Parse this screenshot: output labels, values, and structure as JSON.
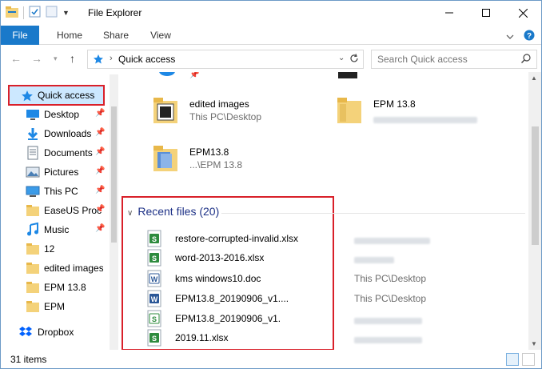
{
  "window": {
    "title": "File Explorer"
  },
  "ribbon": {
    "tabs": [
      "File",
      "Home",
      "Share",
      "View"
    ]
  },
  "address": {
    "path": "Quick access"
  },
  "search": {
    "placeholder": "Search Quick access"
  },
  "nav": {
    "quick_access": "Quick access",
    "items": [
      {
        "label": "Desktop",
        "icon": "desktop-icon",
        "pinned": true
      },
      {
        "label": "Downloads",
        "icon": "downloads-icon",
        "pinned": true
      },
      {
        "label": "Documents",
        "icon": "documents-icon",
        "pinned": true
      },
      {
        "label": "Pictures",
        "icon": "pictures-icon",
        "pinned": true
      },
      {
        "label": "This PC",
        "icon": "this-pc-icon",
        "pinned": true
      },
      {
        "label": "EaseUS Proc",
        "icon": "folder-icon",
        "pinned": true
      },
      {
        "label": "Music",
        "icon": "music-icon",
        "pinned": true
      },
      {
        "label": "12",
        "icon": "folder-icon",
        "pinned": false
      },
      {
        "label": "edited images",
        "icon": "folder-icon",
        "pinned": false
      },
      {
        "label": "EPM 13.8",
        "icon": "folder-icon",
        "pinned": false
      },
      {
        "label": "EPM",
        "icon": "folder-icon",
        "pinned": false
      }
    ],
    "dropbox": "Dropbox"
  },
  "frequent": [
    {
      "name": "edited images",
      "location": "This PC\\Desktop"
    },
    {
      "name": "EPM 13.8",
      "location": ""
    },
    {
      "name": "EPM13.8",
      "location": "...\\EPM 13.8"
    }
  ],
  "recent": {
    "heading": "Recent files (20)",
    "files": [
      {
        "name": "restore-corrupted-invalid.xlsx",
        "type": "xlsx",
        "location": ""
      },
      {
        "name": "word-2013-2016.xlsx",
        "type": "xlsx",
        "location": ""
      },
      {
        "name": "kms windows10.doc",
        "type": "doc",
        "location": "This PC\\Desktop"
      },
      {
        "name": "EPM13.8_20190906_v1....",
        "type": "doc",
        "location": "This PC\\Desktop"
      },
      {
        "name": "EPM13.8_20190906_v1.",
        "type": "xlsx",
        "location": ""
      },
      {
        "name": "2019.11.xlsx",
        "type": "xlsx",
        "location": ""
      }
    ]
  },
  "status": {
    "items": "31 items"
  },
  "colors": {
    "accent": "#1979ca",
    "highlight_border": "#d9202a",
    "selection": "#cce8ff",
    "heading_blue": "#1e3287",
    "folder": "#f4d27a",
    "excel_green": "#2e8b3e",
    "word_blue": "#2b5797"
  }
}
